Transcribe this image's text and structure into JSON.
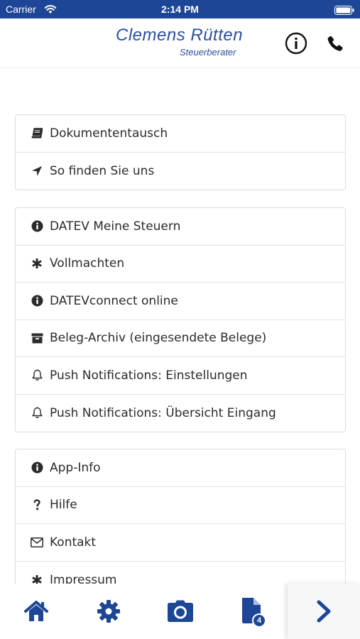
{
  "status_bar": {
    "carrier": "Carrier",
    "time": "2:14 PM"
  },
  "header": {
    "name": "Clemens Rütten",
    "subtitle": "Steuerberater",
    "info_icon": "info-circle-icon",
    "phone_icon": "phone-icon"
  },
  "groups": [
    [
      {
        "label": "Dokumententausch",
        "icon": "book-icon"
      },
      {
        "label": "So finden Sie uns",
        "icon": "location-arrow-icon"
      }
    ],
    [
      {
        "label": "DATEV Meine Steuern",
        "icon": "info-circle-icon"
      },
      {
        "label": "Vollmachten",
        "icon": "asterisk-icon"
      },
      {
        "label": "DATEVconnect online",
        "icon": "info-circle-icon"
      },
      {
        "label": "Beleg-Archiv (eingesendete Belege)",
        "icon": "archive-icon"
      },
      {
        "label": "Push Notifications: Einstellungen",
        "icon": "bell-icon"
      },
      {
        "label": "Push Notifications: Übersicht Eingang",
        "icon": "bell-icon"
      }
    ],
    [
      {
        "label": "App-Info",
        "icon": "info-circle-icon"
      },
      {
        "label": "Hilfe",
        "icon": "question-icon"
      },
      {
        "label": "Kontakt",
        "icon": "envelope-icon"
      },
      {
        "label": "Impressum",
        "icon": "asterisk-icon"
      }
    ]
  ],
  "tabbar": {
    "items": [
      {
        "icon": "home-icon"
      },
      {
        "icon": "gear-icon"
      },
      {
        "icon": "camera-icon"
      },
      {
        "icon": "document-icon",
        "badge": "4"
      },
      {
        "icon": "chevron-right-icon"
      }
    ]
  },
  "colors": {
    "brand": "#1d4796",
    "text": "#2b2b2b",
    "border": "#dcdcdc"
  }
}
